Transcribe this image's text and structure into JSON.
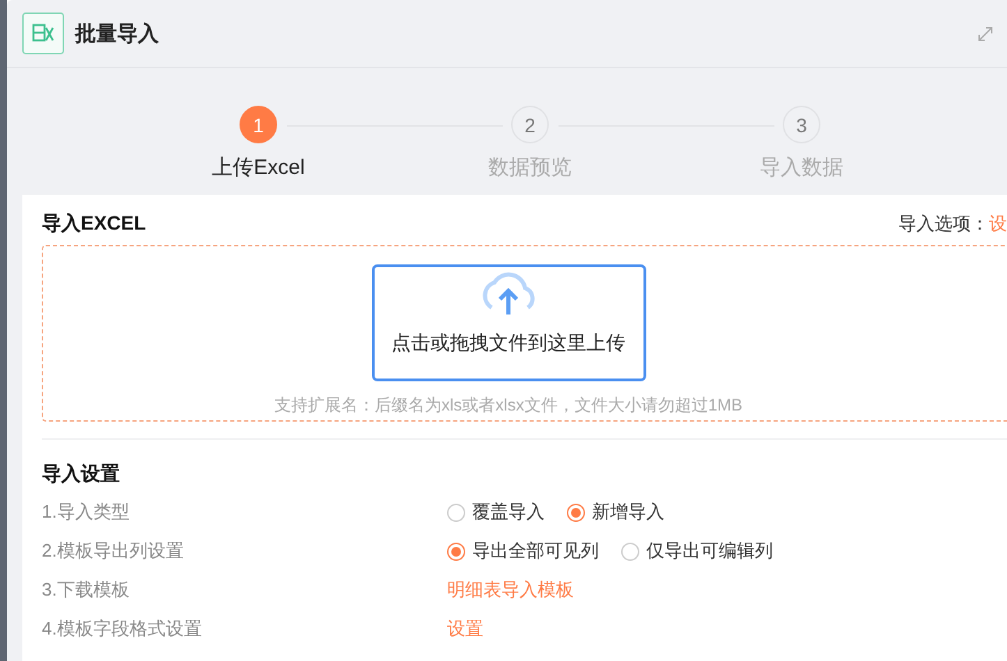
{
  "window": {
    "title": "批量导入"
  },
  "steps": [
    {
      "number": "1",
      "label": "上传Excel",
      "selected": true
    },
    {
      "number": "2",
      "label": "数据预览",
      "selected": false
    },
    {
      "number": "3",
      "label": "导入数据",
      "selected": false
    }
  ],
  "upload_section": {
    "title": "导入EXCEL",
    "options_label": "导入选项：",
    "options_link": "设"
  },
  "dropzone": {
    "prompt": "点击或拖拽文件到这里上传",
    "hint": "支持扩展名：后缀名为xls或者xlsx文件，文件大小请勿超过1MB"
  },
  "settings": {
    "title": "导入设置",
    "rows": [
      {
        "label": "1.导入类型",
        "kind": "radio",
        "options": [
          {
            "label": "覆盖导入",
            "selected": false
          },
          {
            "label": "新增导入",
            "selected": true
          }
        ]
      },
      {
        "label": "2.模板导出列设置",
        "kind": "radio",
        "options": [
          {
            "label": "导出全部可见列",
            "selected": true
          },
          {
            "label": "仅导出可编辑列",
            "selected": false
          }
        ]
      },
      {
        "label": "3.下载模板",
        "kind": "link",
        "link": "明细表导入模板"
      },
      {
        "label": "4.模板字段格式设置",
        "kind": "link",
        "link": "设置"
      }
    ]
  }
}
